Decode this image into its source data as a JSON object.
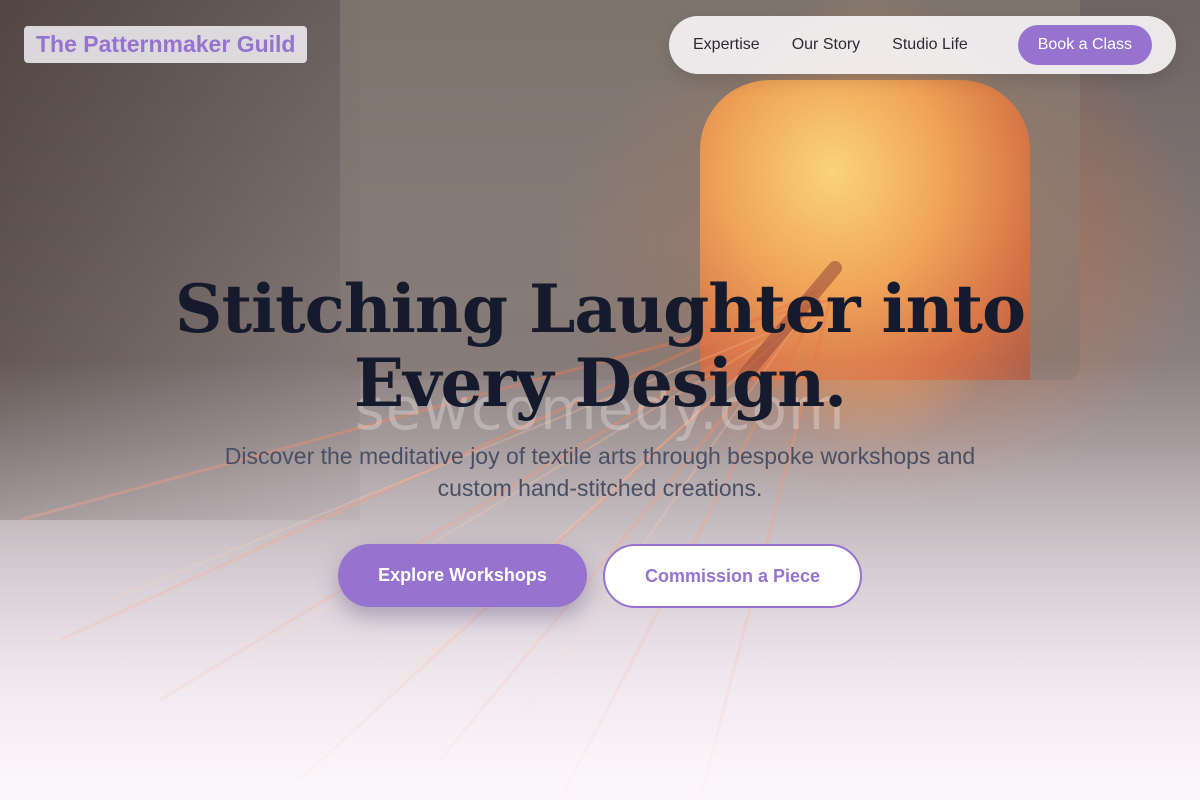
{
  "brand": {
    "name": "The Patternmaker Guild"
  },
  "nav": {
    "links": [
      {
        "label": "Expertise"
      },
      {
        "label": "Our Story"
      },
      {
        "label": "Studio Life"
      }
    ],
    "cta_label": "Book a Class"
  },
  "hero": {
    "headline_line1": "Stitching Laughter into",
    "headline_line2": "Every Design.",
    "subtitle_line1": "Discover the meditative joy of textile arts through bespoke workshops and",
    "subtitle_line2": "custom hand-stitched creations.",
    "primary_button": "Explore Workshops",
    "secondary_button": "Commission a Piece",
    "watermark": "sewcomedy.com"
  },
  "colors": {
    "accent": "#9573cf",
    "headline": "#151b2c",
    "subtitle": "#4a4f63"
  }
}
